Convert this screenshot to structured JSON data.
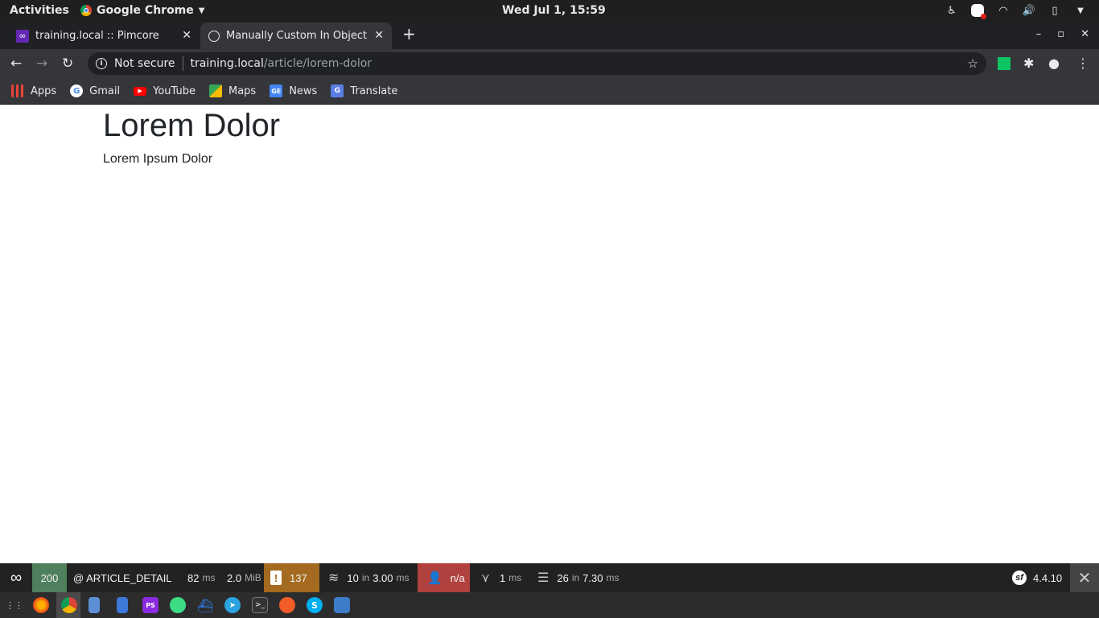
{
  "system_bar": {
    "activities": "Activities",
    "app_name": "Google Chrome",
    "clock": "Wed Jul  1, 15:59"
  },
  "tabs": [
    {
      "title": "training.local :: Pimcore",
      "active": false
    },
    {
      "title": "Manually Custom In Object",
      "active": true
    }
  ],
  "toolbar": {
    "security": "Not secure",
    "url_host": "training.local",
    "url_path": "/article/lorem-dolor"
  },
  "bookmarks": [
    {
      "label": "Apps",
      "icon": "apps-grid-icon"
    },
    {
      "label": "Gmail",
      "icon": "google-icon"
    },
    {
      "label": "YouTube",
      "icon": "youtube-icon"
    },
    {
      "label": "Maps",
      "icon": "maps-icon"
    },
    {
      "label": "News",
      "icon": "news-icon"
    },
    {
      "label": "Translate",
      "icon": "translate-icon"
    }
  ],
  "page": {
    "heading": "Lorem Dolor",
    "body": "Lorem Ipsum Dolor"
  },
  "debug_toolbar": {
    "status": "200",
    "route": "@ ARTICLE_DETAIL",
    "time_value": "82",
    "time_unit": "ms",
    "memory_value": "2.0",
    "memory_unit": "MiB",
    "logs": "137",
    "cache_count": "10",
    "cache_in": "in",
    "cache_time": "3.00",
    "cache_unit": "ms",
    "user": "n/a",
    "twig_time": "1",
    "twig_unit": "ms",
    "db_queries": "26",
    "db_in": "in",
    "db_time": "7.30",
    "db_unit": "ms",
    "symfony_version": "4.4.10"
  },
  "colors": {
    "status_ok": "#4f805d",
    "logs_warning": "#a46a1f",
    "user_anon": "#b0413e",
    "extension_green": "#0dc463"
  }
}
